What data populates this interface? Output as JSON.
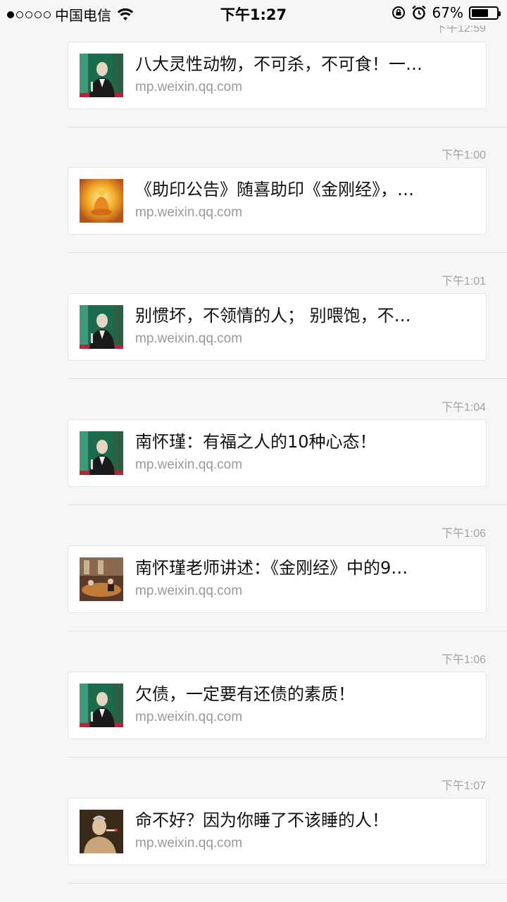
{
  "status_bar": {
    "carrier": "中国电信",
    "time": "下午1:27",
    "battery": "67%",
    "battery_level": 0.67,
    "signal_strength": 1
  },
  "messages": [
    {
      "time": "下午12:59",
      "title": "八大灵性动物，不可杀，不可食！一…",
      "domain": "mp.weixin.qq.com",
      "thumb": "elder-portrait-icon"
    },
    {
      "time": "下午1:00",
      "title": "《助印公告》随喜助印《金刚经》，…",
      "domain": "mp.weixin.qq.com",
      "thumb": "buddha-icon"
    },
    {
      "time": "下午1:01",
      "title": "别惯坏，不领情的人； 别喂饱，不…",
      "domain": "mp.weixin.qq.com",
      "thumb": "elder-portrait-icon"
    },
    {
      "time": "下午1:04",
      "title": "南怀瑾：有福之人的10种心态！",
      "domain": "mp.weixin.qq.com",
      "thumb": "elder-portrait-icon"
    },
    {
      "time": "下午1:06",
      "title": "南怀瑾老师讲述：《金刚经》中的9…",
      "domain": "mp.weixin.qq.com",
      "thumb": "lecture-room-icon"
    },
    {
      "time": "下午1:06",
      "title": "欠债，一定要有还债的素质！",
      "domain": "mp.weixin.qq.com",
      "thumb": "elder-portrait-icon"
    },
    {
      "time": "下午1:07",
      "title": "命不好？因为你睡了不该睡的人！",
      "domain": "mp.weixin.qq.com",
      "thumb": "elder-smoking-icon"
    }
  ]
}
